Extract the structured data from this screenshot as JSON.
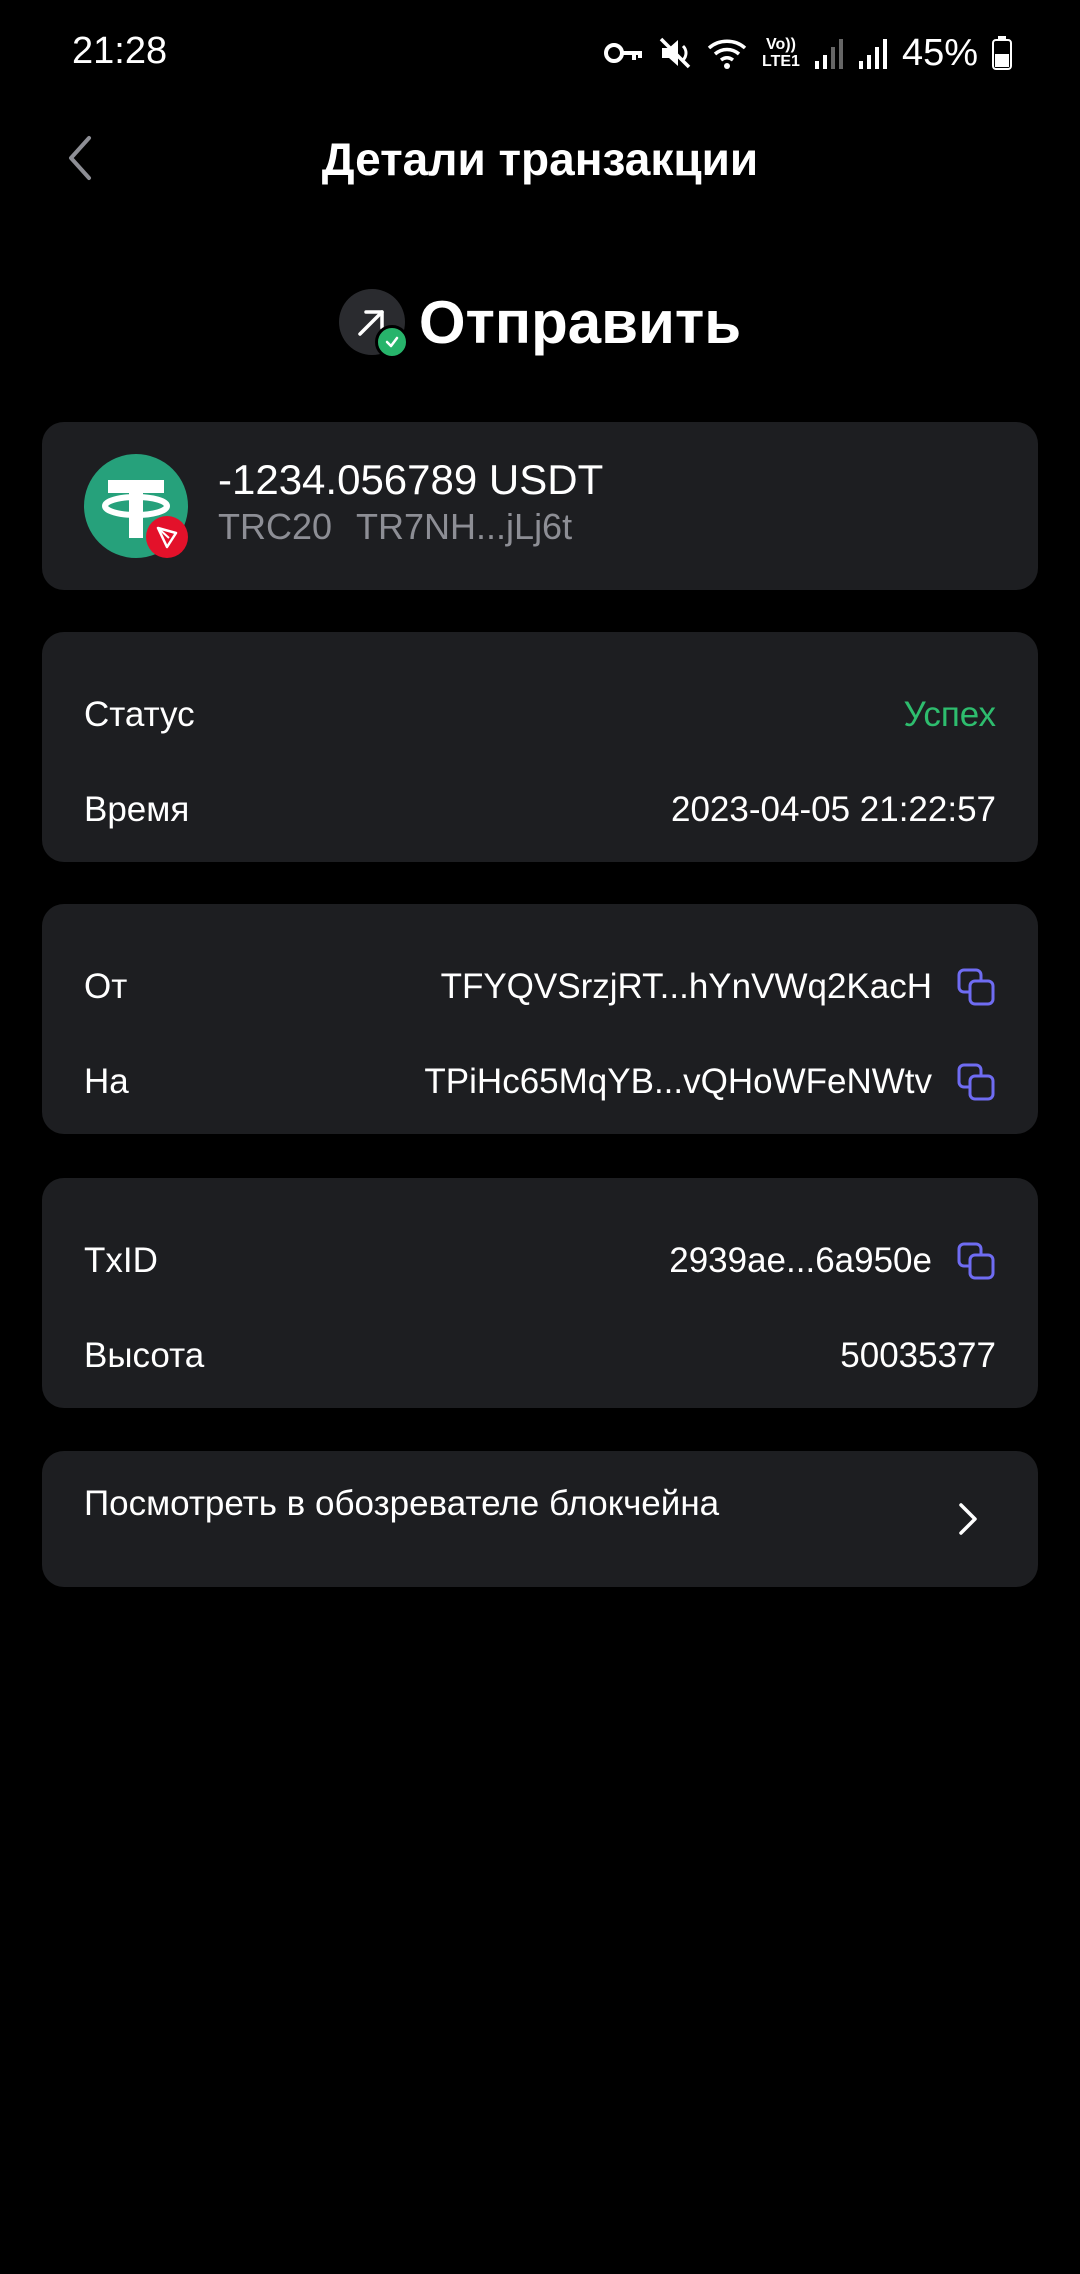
{
  "status_bar": {
    "time": "21:28",
    "lte_top": "Vo))",
    "lte_bottom": "LTE1",
    "battery": "45%",
    "icons": [
      "key-icon",
      "mute-icon",
      "wifi-icon",
      "signal-icon",
      "signal-icon",
      "battery-icon"
    ]
  },
  "header": {
    "title": "Детали транзакции",
    "back_icon": "chevron-left-icon"
  },
  "hero": {
    "label": "Отправить",
    "icon": "send-arrow-icon",
    "badge_icon": "check-icon"
  },
  "asset": {
    "amount": "-1234.056789 USDT",
    "network": "TRC20",
    "address_short": "TR7NH...jLj6t",
    "logo_icon": "tether-icon",
    "chain_icon": "tron-icon"
  },
  "status_card": {
    "status_label": "Статус",
    "status_value": "Успех",
    "time_label": "Время",
    "time_value": "2023-04-05 21:22:57"
  },
  "address_card": {
    "from_label": "От",
    "from_value": "TFYQVSrzjRT...hYnVWq2KacH",
    "to_label": "На",
    "to_value": "TPiHc65MqYB...vQHoWFeNWtv"
  },
  "tx_card": {
    "txid_label": "TxID",
    "txid_value": "2939ae...6a950e",
    "height_label": "Высота",
    "height_value": "50035377"
  },
  "explorer": {
    "label": "Посмотреть в обозревателе блокчейна"
  },
  "colors": {
    "background": "#000000",
    "card": "#1d1e21",
    "success": "#2ebd6e",
    "copy_icon": "#6f6cf2",
    "muted_text": "#8d8e95",
    "tether": "#26a17b",
    "tron": "#e3112a"
  }
}
